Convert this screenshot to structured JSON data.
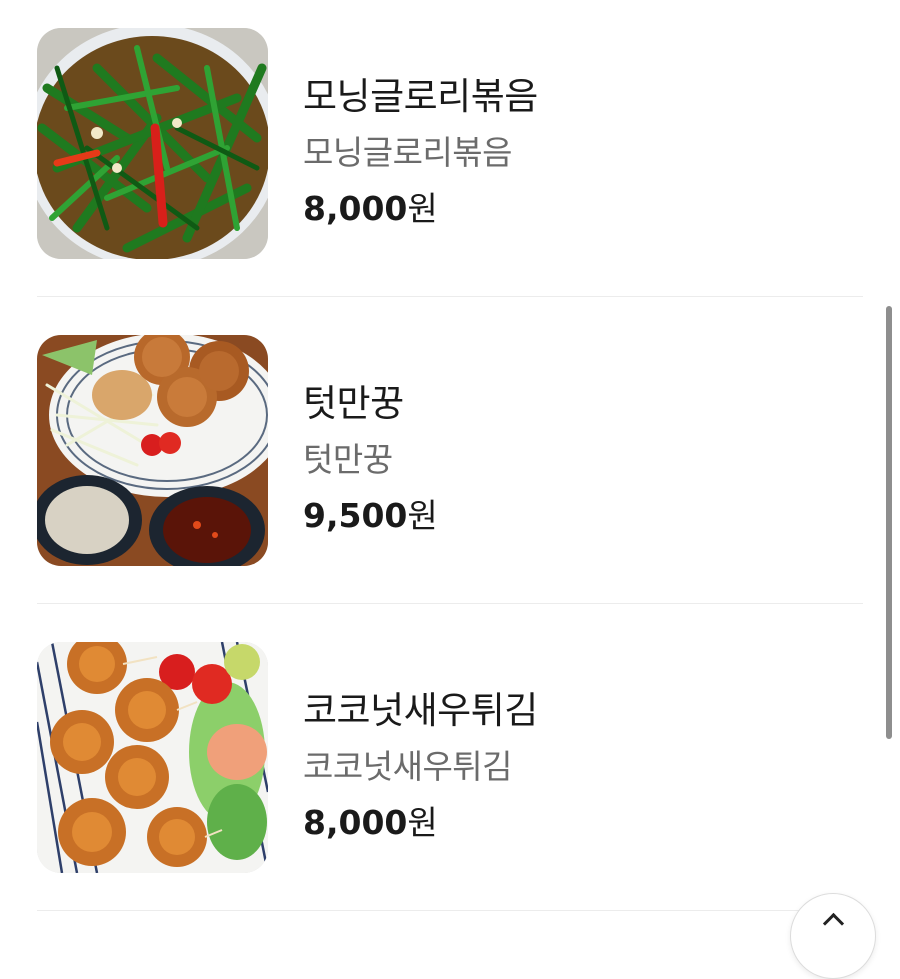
{
  "menu": {
    "items": [
      {
        "name": "모닝글로리볶음",
        "description": "모닝글로리볶음",
        "price": "8,000",
        "price_unit": "원",
        "image_icon": "stir-fried-greens-photo"
      },
      {
        "name": "텃만꿍",
        "description": "텃만꿍",
        "price": "9,500",
        "price_unit": "원",
        "image_icon": "shrimp-cakes-photo"
      },
      {
        "name": "코코넛새우튀김",
        "description": "코코넛새우튀김",
        "price": "8,000",
        "price_unit": "원",
        "image_icon": "coconut-shrimp-photo"
      }
    ]
  },
  "scroll_top_button": {
    "icon": "chevron-up-icon"
  },
  "colors": {
    "text_primary": "#1a1a1a",
    "text_secondary": "#6b6b6b",
    "divider": "#ececec",
    "scrollbar": "#8e8e8e"
  }
}
